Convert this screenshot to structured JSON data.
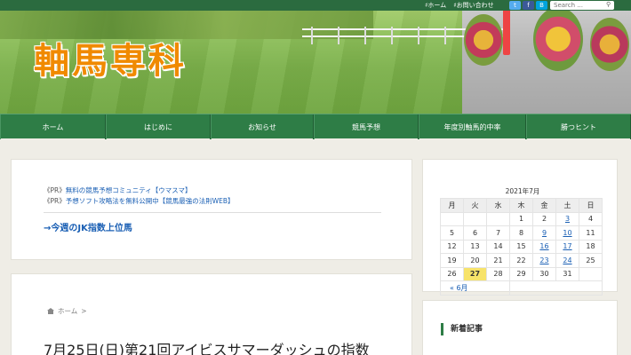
{
  "topbar": {
    "links": [
      "♯ホーム",
      "♯お問い合わせ"
    ],
    "social": [
      "t",
      "f",
      "B"
    ],
    "search_placeholder": "Search ..."
  },
  "header": {
    "logo": "軸馬専科"
  },
  "nav": {
    "items": [
      {
        "label": "ホーム",
        "width": 119
      },
      {
        "label": "はじめに",
        "width": 118
      },
      {
        "label": "お知らせ",
        "width": 116
      },
      {
        "label": "競馬予想",
        "width": 118
      },
      {
        "label": "年度別軸馬的中率",
        "width": 121
      },
      {
        "label": "勝つヒント",
        "width": 118
      }
    ]
  },
  "promo": {
    "line1_prefix": "《PR》",
    "line1_link": "無料の競馬予想コミュニティ【ウマスマ】",
    "line2_prefix": "《PR》",
    "line2_link": "予想ソフト攻略法を無料公開中【競馬最強の法則WEB】",
    "jk_link": "→今週のJK指数上位馬"
  },
  "article": {
    "breadcrumb_home": "ホーム",
    "breadcrumb_sep": ">",
    "title": "7月25日(日)第21回アイビスサマーダッシュの指数"
  },
  "calendar": {
    "title": "2021年7月",
    "weekdays": [
      "月",
      "火",
      "水",
      "木",
      "金",
      "土",
      "日"
    ],
    "weeks": [
      [
        "",
        "",
        "",
        "1",
        "2",
        "3",
        "4"
      ],
      [
        "5",
        "6",
        "7",
        "8",
        "9",
        "10",
        "11"
      ],
      [
        "12",
        "13",
        "14",
        "15",
        "16",
        "17",
        "18"
      ],
      [
        "19",
        "20",
        "21",
        "22",
        "23",
        "24",
        "25"
      ],
      [
        "26",
        "27",
        "28",
        "29",
        "30",
        "31",
        ""
      ]
    ],
    "linked_days": [
      "3",
      "9",
      "10",
      "16",
      "17",
      "23",
      "24"
    ],
    "today": "27",
    "prev_link": "« 6月"
  },
  "sidebar": {
    "new_posts_heading": "新着記事"
  }
}
